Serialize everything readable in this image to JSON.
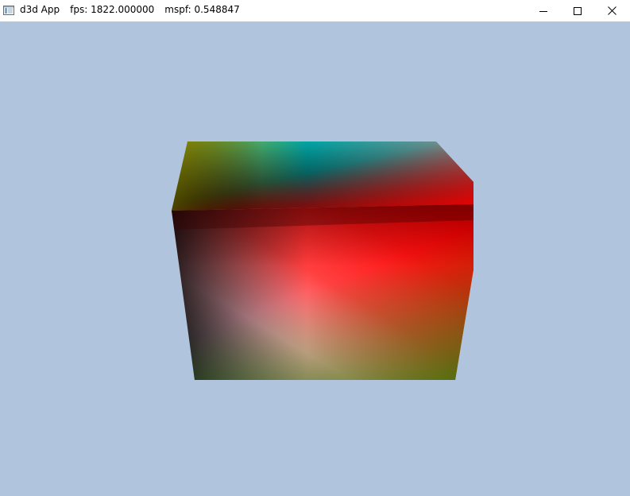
{
  "window": {
    "app_name": "d3d App",
    "fps_label": "fps: 1822.000000",
    "mspf_label": "mspf: 0.548847",
    "icon": "app-window-icon",
    "controls": {
      "minimize_icon": "minimize-icon",
      "maximize_icon": "maximize-icon",
      "close_icon": "close-icon"
    }
  },
  "viewport": {
    "background_color": "#b0c4de",
    "scene": "rotating-colored-cube",
    "cube_colors": {
      "corner_top_left_back": "#c8c000",
      "corner_top_back_mid": "#00a0a0",
      "corner_top_right_back": "#808080",
      "corner_front_top_left": "#000000",
      "corner_front_top_right": "#ff0000",
      "corner_front_bottom_left": "#ffb0c0",
      "corner_front_bottom_right": "#3a7000"
    }
  }
}
